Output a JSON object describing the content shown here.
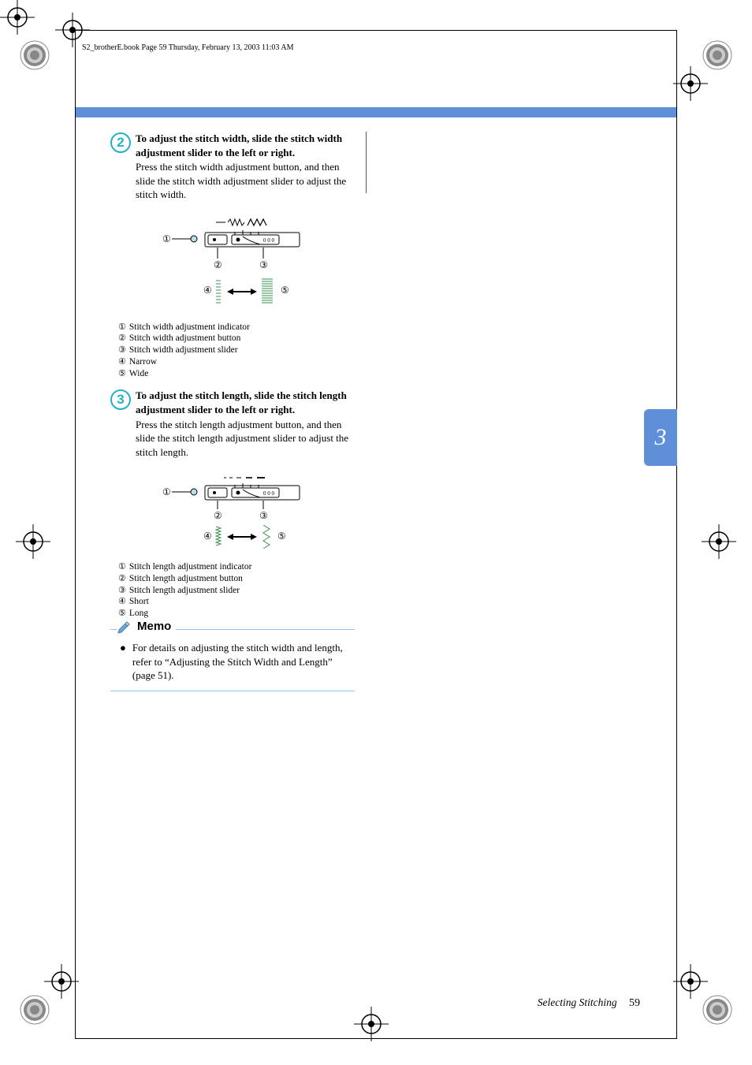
{
  "header": "S2_brotherE.book  Page 59  Thursday, February 13, 2003  11:03 AM",
  "side_tab": "3",
  "steps": [
    {
      "num": "2",
      "title": "To adjust the stitch width, slide the stitch width adjustment slider to the left or right.",
      "desc": "Press the stitch width adjustment button, and then slide the stitch width adjustment slider to adjust the stitch width.",
      "legend": [
        "Stitch width adjustment indicator",
        "Stitch width adjustment button",
        "Stitch width adjustment slider",
        "Narrow",
        "Wide"
      ]
    },
    {
      "num": "3",
      "title": "To adjust the stitch length, slide the stitch length adjustment slider to the left or right.",
      "desc": "Press the stitch length adjustment button, and then slide the stitch length adjustment slider to adjust the stitch length.",
      "legend": [
        "Stitch length adjustment indicator",
        "Stitch length adjustment button",
        "Stitch length adjustment slider",
        "Short",
        "Long"
      ]
    }
  ],
  "memo": {
    "title": "Memo",
    "item": "For details on adjusting the stitch width and length, refer to “Adjusting the Stitch Width and Length” (page 51)."
  },
  "footer": {
    "section": "Selecting Stitching",
    "page": "59"
  },
  "circled": [
    "①",
    "②",
    "③",
    "④",
    "⑤"
  ],
  "icons": {
    "memo": "pencil-note-icon"
  }
}
